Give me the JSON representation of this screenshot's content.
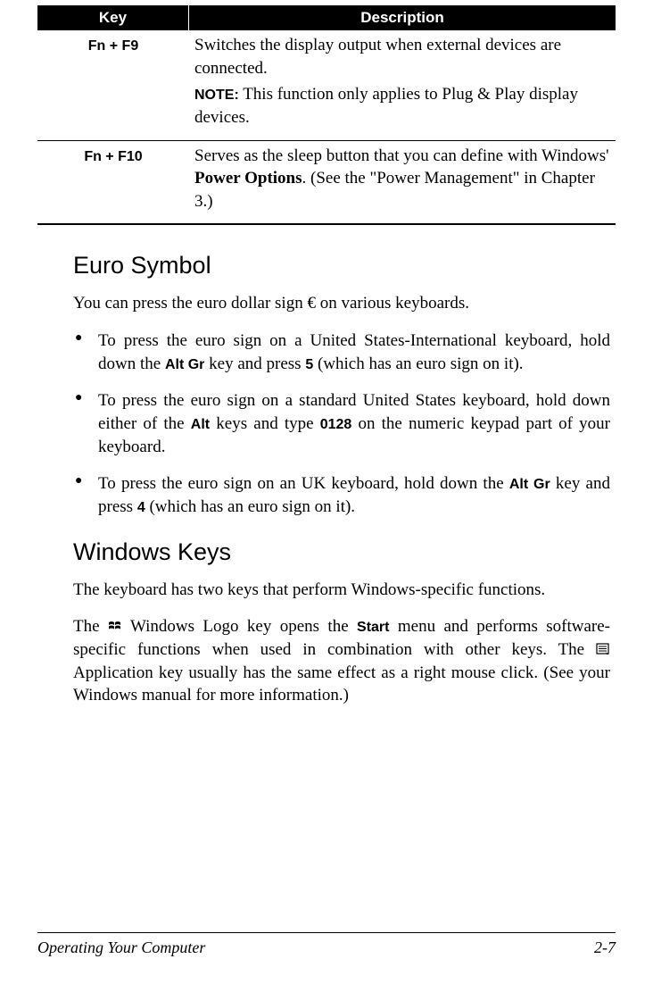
{
  "table": {
    "headers": {
      "key": "Key",
      "desc": "Description"
    },
    "rows": [
      {
        "key": "Fn + F9",
        "desc_1": "Switches the display output when external devices are connected.",
        "note_label": "NOTE:",
        "note_text": " This function only applies to Plug & Play display devices."
      },
      {
        "key": "Fn + F10",
        "desc_prefix": "Serves as the sleep button that you can define with Windows' ",
        "desc_bold": "Power Options",
        "desc_suffix": ". (See the \"Power Management\" in Chapter 3.)"
      }
    ]
  },
  "sections": {
    "euro": {
      "heading": "Euro Symbol",
      "intro_prefix": "You can press the euro dollar sign ",
      "intro_suffix": " on various keyboards.",
      "bullets": [
        {
          "t1": "To press the euro sign on a United States-International keyboard, hold down the ",
          "k1": "Alt Gr",
          "t2": " key and press ",
          "k2": "5",
          "t3": " (which has an euro sign on it)."
        },
        {
          "t1": "To press the euro sign on a standard United States keyboard, hold down either of the ",
          "k1": "Alt",
          "t2": " keys and type ",
          "k2": "0128",
          "t3": " on the numeric keypad part of your keyboard."
        },
        {
          "t1": "To press the euro sign on an UK keyboard, hold down the ",
          "k1": "Alt Gr",
          "t2": " key and press ",
          "k2": "4",
          "t3": " (which has an euro sign on it)."
        }
      ]
    },
    "winkeys": {
      "heading": "Windows Keys",
      "intro": "The keyboard has two keys that perform Windows-specific functions.",
      "p2_a": "The ",
      "p2_b": " Windows Logo key opens the ",
      "p2_start": "Start",
      "p2_c": " menu and performs software-specific functions when used in combination with other keys. The ",
      "p2_d": " Application key usually has the same effect as a right mouse click. (See your Windows manual for more information.)"
    }
  },
  "footer": {
    "title": "Operating Your Computer",
    "page": "2-7"
  }
}
